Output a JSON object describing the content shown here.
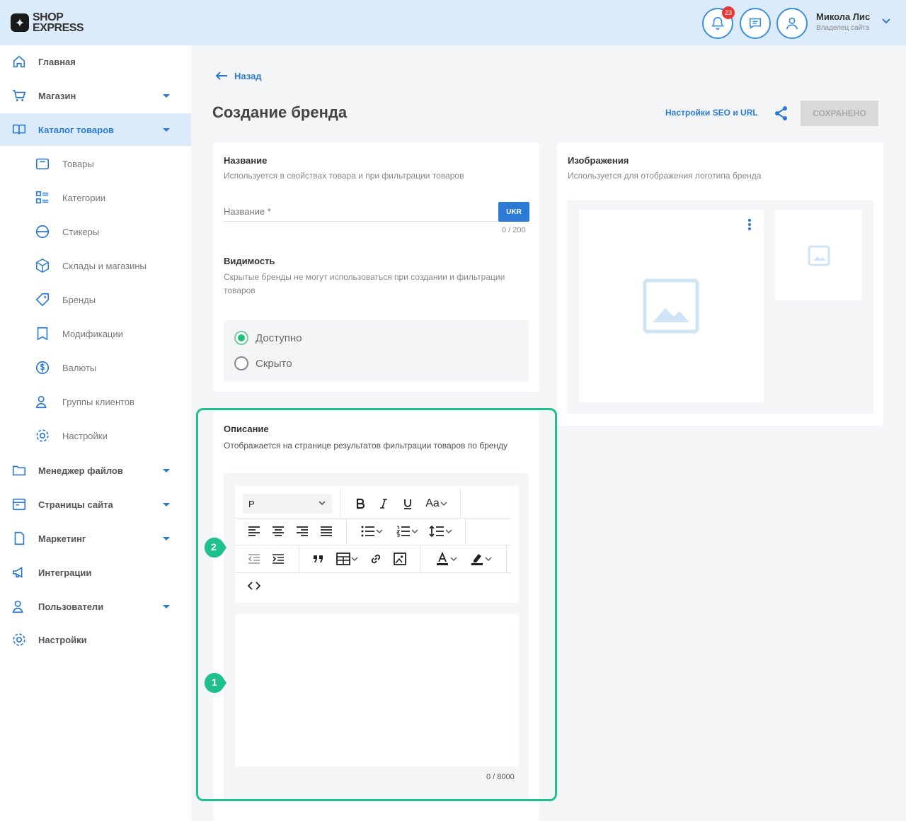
{
  "header": {
    "logo_line1": "SHOP",
    "logo_line2": "EXPRESS",
    "notifications_count": "23",
    "user_name": "Микола Лис",
    "user_role": "Владелец сайта"
  },
  "sidebar": {
    "items": [
      {
        "label": "Главная",
        "icon": "home-icon"
      },
      {
        "label": "Магазин",
        "icon": "cart-icon"
      },
      {
        "label": "Каталог товаров",
        "icon": "book-icon"
      },
      {
        "label": "Менеджер файлов",
        "icon": "folder-icon"
      },
      {
        "label": "Страницы сайта",
        "icon": "pages-icon"
      },
      {
        "label": "Маркетинг",
        "icon": "marketing-icon"
      },
      {
        "label": "Интеграции",
        "icon": "megaphone-icon"
      },
      {
        "label": "Пользователи",
        "icon": "users-icon"
      },
      {
        "label": "Настройки",
        "icon": "gear-icon"
      }
    ],
    "sub_items": [
      {
        "label": "Товары",
        "icon": "box-icon"
      },
      {
        "label": "Категории",
        "icon": "categories-icon"
      },
      {
        "label": "Стикеры",
        "icon": "sticker-icon"
      },
      {
        "label": "Склады и магазины",
        "icon": "warehouse-icon"
      },
      {
        "label": "Бренды",
        "icon": "tag-icon"
      },
      {
        "label": "Модификации",
        "icon": "modification-icon"
      },
      {
        "label": "Валюты",
        "icon": "currency-icon"
      },
      {
        "label": "Группы клиентов",
        "icon": "client-group-icon"
      },
      {
        "label": "Настройки",
        "icon": "gear-icon"
      }
    ]
  },
  "page": {
    "back_label": "Назад",
    "title": "Создание бренда",
    "seo_link": "Настройки SEO и URL",
    "save_label": "СОХРАНЕНО"
  },
  "name_card": {
    "title": "Название",
    "subtitle": "Используется в свойствах товара и при фильтрации товаров",
    "input_placeholder": "Название *",
    "lang_label": "UKR",
    "counter": "0 / 200",
    "visibility_title": "Видимость",
    "visibility_subtitle": "Скрытые бренды не могут использоваться при создании и фильтрации товаров",
    "options": [
      {
        "label": "Доступно",
        "selected": true
      },
      {
        "label": "Скрыто",
        "selected": false
      }
    ]
  },
  "images_card": {
    "title": "Изображения",
    "subtitle": "Используется для отображения логотипа бренда"
  },
  "description_card": {
    "title": "Описание",
    "subtitle": "Отображается на странице результатов фильтрации товаров по бренду",
    "format_value": "P",
    "font_size_label": "Aa",
    "counter": "0 / 8000",
    "accent_color": "#1fbf8f"
  },
  "markers": [
    "1",
    "2"
  ]
}
